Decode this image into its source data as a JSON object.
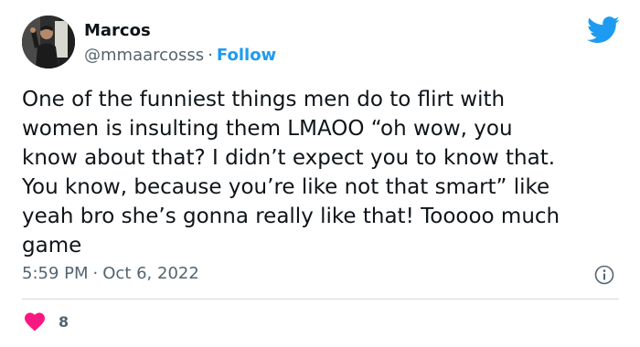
{
  "author": {
    "name": "Marcos",
    "handle": "@mmaarcosss",
    "separator": "·",
    "follow_label": "Follow"
  },
  "tweet": {
    "text": "One of the funniest things men do to flirt with\nwomen is insulting them LMAOO “oh wow, you\nknow about that? I didn’t expect you to know that.\nYou know, because you’re like not that smart” like\nyeah bro she’s gonna really like that! Tooooo much\ngame",
    "time": "5:59 PM",
    "separator": "·",
    "date": "Oct 6, 2022"
  },
  "engagement": {
    "likes": "8"
  },
  "icons": {
    "brand": "twitter-bird-icon",
    "info": "info-icon",
    "like": "heart-icon"
  },
  "colors": {
    "twitter_blue": "#1d9bf0",
    "heart_red": "#f91880",
    "muted_text": "#536471",
    "main_text": "#0f1419"
  }
}
